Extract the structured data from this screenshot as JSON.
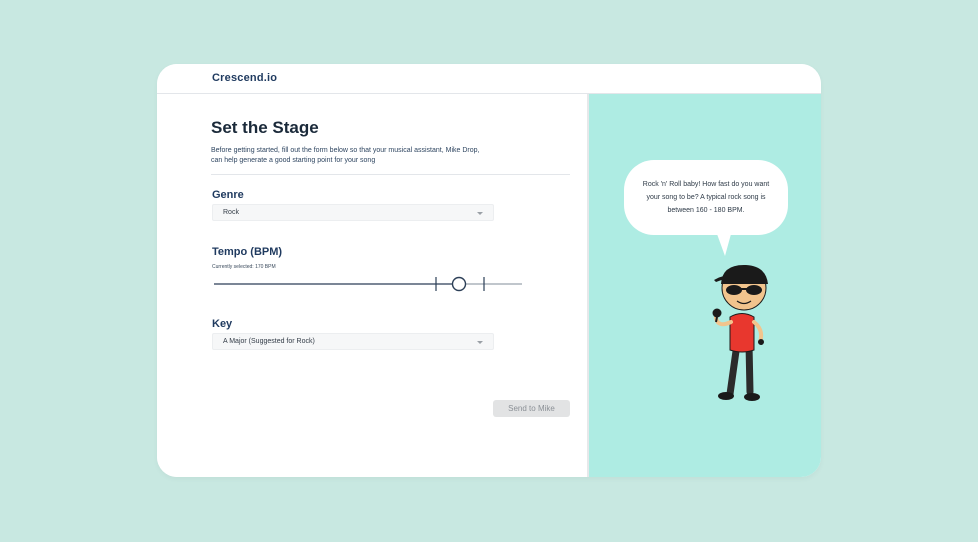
{
  "app": {
    "brand": "Crescend.io"
  },
  "form": {
    "title": "Set the Stage",
    "description": "Before getting started, fill out the form below so that your musical assistant, Mike Drop, can help generate a good starting point for your song",
    "genre": {
      "label": "Genre",
      "value": "Rock"
    },
    "tempo": {
      "label": "Tempo (BPM)",
      "current_text": "Currently selected: 170 BPM",
      "value_bpm": 170,
      "suggested_range_bpm": [
        160,
        180
      ]
    },
    "key": {
      "label": "Key",
      "value": "A Major (Suggested for Rock)"
    },
    "submit_label": "Send to Mike"
  },
  "assistant": {
    "speech": "Rock 'n' Roll baby! How fast do you want your song to be? A typical rock song is between 160 - 180 BPM."
  },
  "colors": {
    "background": "#c8e8e1",
    "panel": "#aeece3",
    "brand": "#1f3a5f",
    "character_shirt": "#e8372e",
    "character_cap": "#1a1a1a"
  }
}
